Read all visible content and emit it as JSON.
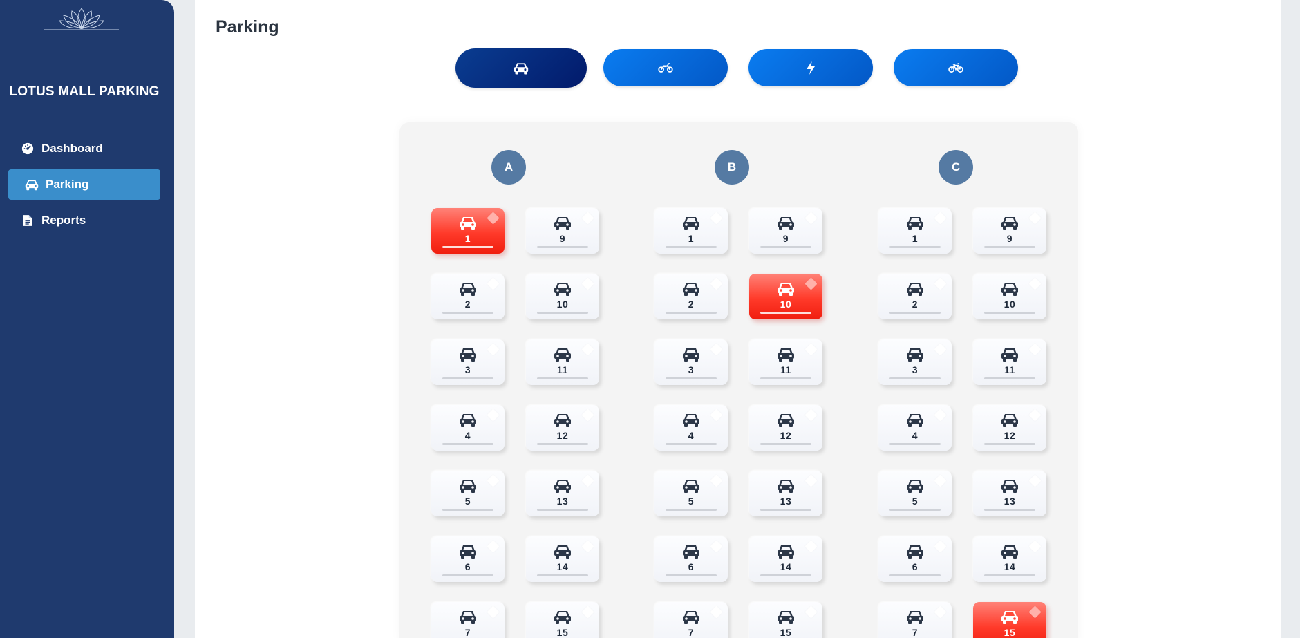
{
  "sidebar": {
    "brand": "LOTUS MALL PARKING",
    "items": [
      {
        "label": "Dashboard",
        "icon": "gauge-icon",
        "active": false
      },
      {
        "label": "Parking",
        "icon": "car-icon",
        "active": true
      },
      {
        "label": "Reports",
        "icon": "document-icon",
        "active": false
      }
    ]
  },
  "main": {
    "title": "Parking",
    "vehicle_tabs": [
      {
        "icon": "car-icon",
        "active": true
      },
      {
        "icon": "motorcycle-icon",
        "active": false
      },
      {
        "icon": "bolt-icon",
        "active": false
      },
      {
        "icon": "bicycle-icon",
        "active": false
      }
    ]
  },
  "lot": {
    "colors": {
      "occupied": "#ff3a2a",
      "free": "#f5f7fb",
      "badge": "#557aa3"
    },
    "sections": [
      {
        "label": "A",
        "columns": [
          [
            "1",
            "2",
            "3",
            "4",
            "5",
            "6",
            "7"
          ],
          [
            "9",
            "10",
            "11",
            "12",
            "13",
            "14",
            "15"
          ]
        ],
        "occupied": [
          "1"
        ]
      },
      {
        "label": "B",
        "columns": [
          [
            "1",
            "2",
            "3",
            "4",
            "5",
            "6",
            "7"
          ],
          [
            "9",
            "10",
            "11",
            "12",
            "13",
            "14",
            "15"
          ]
        ],
        "occupied": [
          "10"
        ]
      },
      {
        "label": "C",
        "columns": [
          [
            "1",
            "2",
            "3",
            "4",
            "5",
            "6",
            "7"
          ],
          [
            "9",
            "10",
            "11",
            "12",
            "13",
            "14",
            "15"
          ]
        ],
        "occupied": [
          "15"
        ]
      }
    ]
  }
}
